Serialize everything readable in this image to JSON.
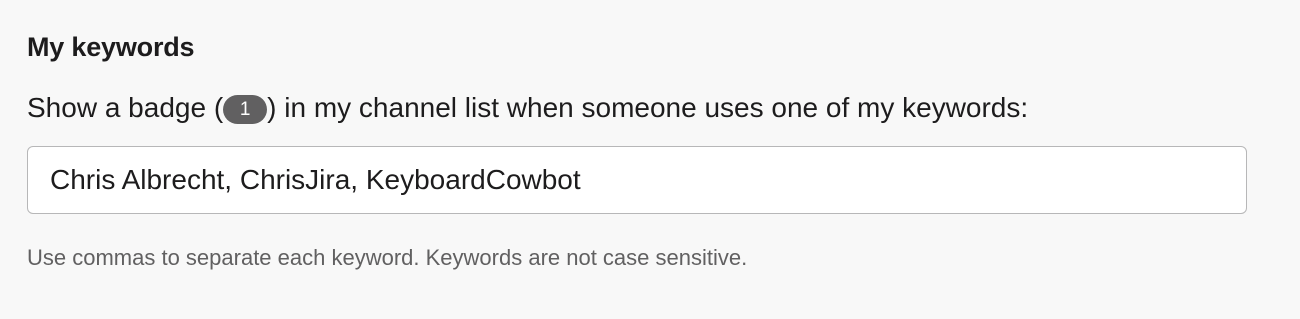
{
  "keywords_section": {
    "heading": "My keywords",
    "description_before": "Show a badge (",
    "badge_count": "1",
    "description_after": ") in my channel list when someone uses one of my keywords:",
    "input_value": "Chris Albrecht, ChrisJira, KeyboardCowbot",
    "hint": "Use commas to separate each keyword. Keywords are not case sensitive."
  },
  "colors": {
    "background": "#f8f8f8",
    "badge": "#616061",
    "text": "#1d1c1d",
    "hint_text": "#616061",
    "input_border": "#b7b7b8"
  }
}
